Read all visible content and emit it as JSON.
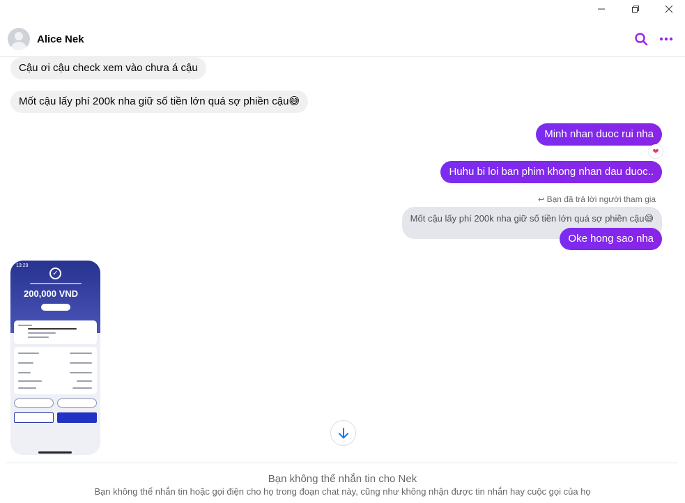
{
  "window": {
    "minimize_icon": "minimize-icon",
    "maximize_icon": "restore-icon",
    "close_icon": "close-icon"
  },
  "header": {
    "contact_name": "Alice Nek",
    "search_icon": "search-icon",
    "more_icon": "more-dots-icon",
    "accent_color": "#9b25e6"
  },
  "messages": [
    {
      "side": "in",
      "text": "Cậu ơi cậu check xem vào chưa á cậu"
    },
    {
      "side": "in",
      "text": "Mốt cậu lấy phí 200k nha giữ số tiền lớn quá sợ phiền cậu😅"
    },
    {
      "side": "out",
      "text": "Minh nhan duoc rui nha",
      "reaction": "heart"
    },
    {
      "side": "out",
      "text": "Huhu bi loi ban phim khong nhan dau duoc.."
    },
    {
      "side": "out",
      "text": "Oke hong sao nha"
    }
  ],
  "reply": {
    "note": "Bạn đã trả lời người tham gia",
    "quoted_text": "Mốt cậu lấy phí 200k nha giữ số tiền lớn quá sợ phiền cậu😅"
  },
  "image_message": {
    "amount": "200,000 VND",
    "time": "13:29"
  },
  "footer": {
    "title": "Bạn không thể nhắn tin cho Nek",
    "subtitle": "Bạn không thể nhắn tin hoặc gọi điện cho họ trong đoạn chat này, cũng như không nhận được tin nhắn hay cuộc gọi của họ"
  }
}
